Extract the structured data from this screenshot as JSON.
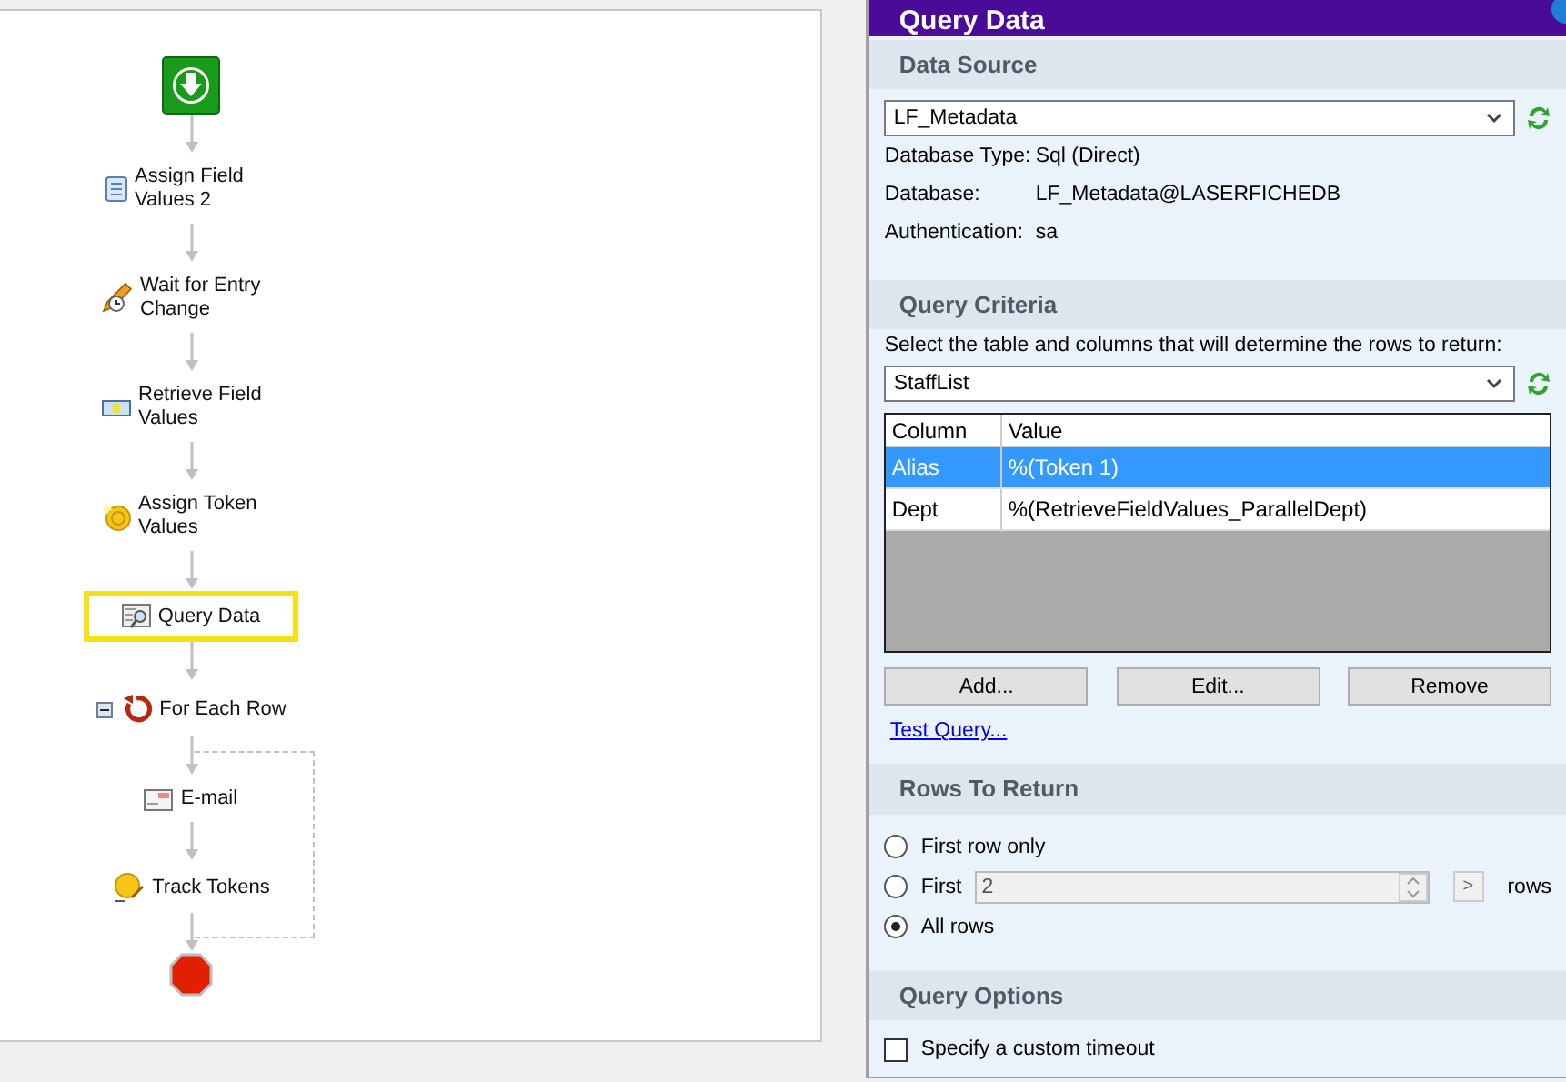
{
  "workflow": {
    "nodes": [
      {
        "kind": "start"
      },
      {
        "kind": "assign",
        "label": "Assign Field Values 2",
        "selected": false
      },
      {
        "kind": "wait",
        "label": "Wait for Entry Change",
        "selected": false
      },
      {
        "kind": "retrieve",
        "label": "Retrieve Field Values",
        "selected": false
      },
      {
        "kind": "token",
        "label": "Assign Token Values",
        "selected": false
      },
      {
        "kind": "query",
        "label": "Query Data",
        "selected": true
      },
      {
        "kind": "loop",
        "label": "For Each Row",
        "selected": false,
        "expanded": true,
        "children": [
          {
            "kind": "email",
            "label": "E-mail",
            "selected": false
          },
          {
            "kind": "track",
            "label": "Track Tokens",
            "selected": false
          }
        ]
      },
      {
        "kind": "end"
      }
    ]
  },
  "panel": {
    "title": "Query Data",
    "data_source": {
      "heading": "Data Source",
      "dropdown": "LF_Metadata",
      "properties": [
        {
          "label": "Database Type:",
          "value": "Sql (Direct)"
        },
        {
          "label": "Database:",
          "value": "LF_Metadata@LASERFICHEDB"
        },
        {
          "label": "Authentication:",
          "value": "sa"
        }
      ]
    },
    "query_criteria": {
      "heading": "Query Criteria",
      "instruction": "Select the table and columns that will determine the rows to return:",
      "dropdown": "StaffList",
      "table": {
        "columns": [
          "Column",
          "Value"
        ],
        "rows": [
          {
            "cells": [
              "Alias",
              "%(Token 1)"
            ],
            "selected": true
          },
          {
            "cells": [
              "Dept",
              "%(RetrieveFieldValues_ParallelDept)"
            ],
            "selected": false
          }
        ]
      },
      "buttons": [
        "Add...",
        "Edit...",
        "Remove"
      ],
      "link": "Test Query..."
    },
    "rows_to_return": {
      "heading": "Rows To Return",
      "options": [
        {
          "kind": "plain",
          "label": "First row only",
          "selected": false
        },
        {
          "kind": "count",
          "label": "First",
          "value": "2",
          "button": ">",
          "suffix": "rows",
          "selected": false
        },
        {
          "kind": "plain",
          "label": "All rows",
          "selected": true
        }
      ]
    },
    "query_options": {
      "heading": "Query Options",
      "checkbox": {
        "label": "Specify a custom timeout",
        "checked": false
      }
    }
  }
}
